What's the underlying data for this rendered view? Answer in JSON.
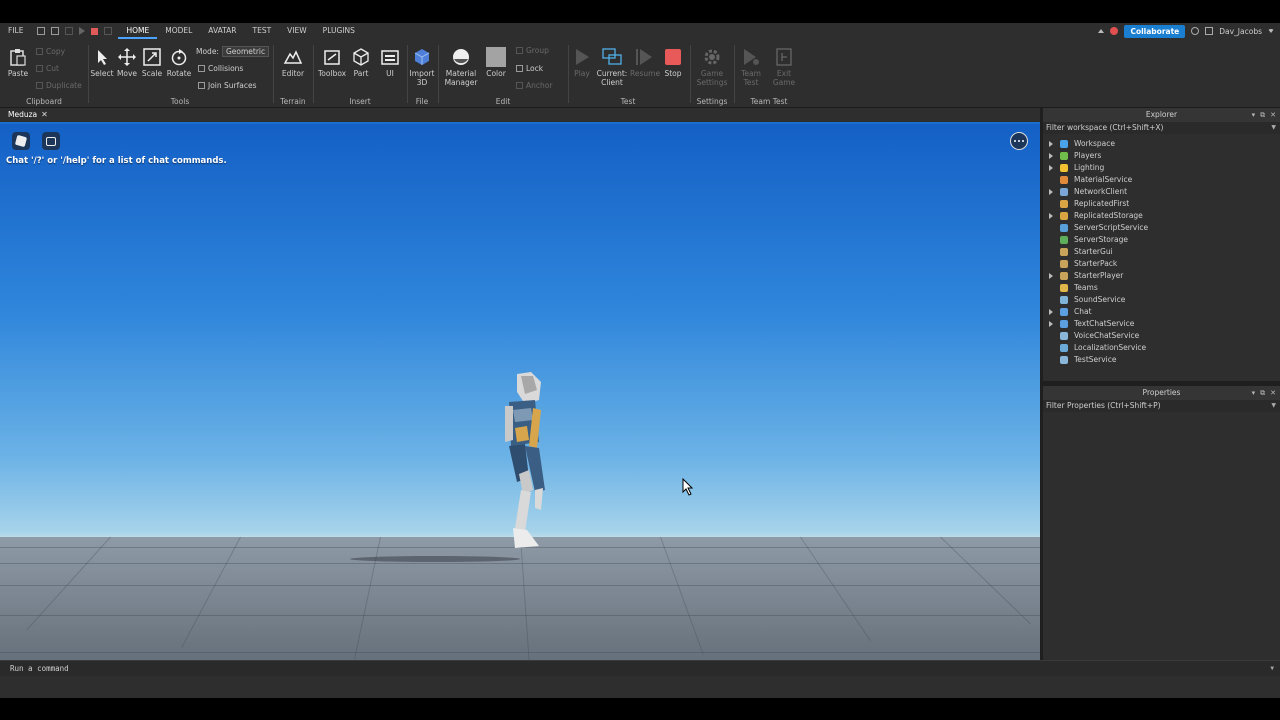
{
  "menu": {
    "file": "FILE",
    "tabs": [
      "HOME",
      "MODEL",
      "AVATAR",
      "TEST",
      "VIEW",
      "PLUGINS"
    ],
    "active_tab": "HOME",
    "collaborate": "Collaborate",
    "username": "Dav_Jacobs"
  },
  "ribbon": {
    "clipboard": {
      "paste": "Paste",
      "copy": "Copy",
      "cut": "Cut",
      "duplicate": "Duplicate",
      "label": "Clipboard"
    },
    "tools": {
      "select": "Select",
      "move": "Move",
      "scale": "Scale",
      "rotate": "Rotate",
      "mode_label": "Mode:",
      "mode_value": "Geometric",
      "collisions": "Collisions",
      "join_surfaces": "Join Surfaces",
      "label": "Tools"
    },
    "terrain": {
      "editor": "Editor",
      "label": "Terrain"
    },
    "insert": {
      "toolbox": "Toolbox",
      "part": "Part",
      "ui": "UI",
      "label": "Insert"
    },
    "file": {
      "import_3d_line1": "Import",
      "import_3d_line2": "3D",
      "label": "File"
    },
    "edit": {
      "material_line1": "Material",
      "material_line2": "Manager",
      "color": "Color",
      "group": "Group",
      "lock": "Lock",
      "anchor": "Anchor",
      "label": "Edit"
    },
    "test": {
      "play": "Play",
      "current_line1": "Current:",
      "current_line2": "Client",
      "resume": "Resume",
      "stop": "Stop",
      "label": "Test"
    },
    "settings": {
      "game_line1": "Game",
      "game_line2": "Settings",
      "label": "Settings"
    },
    "team_test": {
      "team_line1": "Team",
      "team_line2": "Test",
      "exit_line1": "Exit",
      "exit_line2": "Game",
      "label": "Team Test"
    }
  },
  "document_tab": "Meduza",
  "viewport": {
    "chat_hint": "Chat '/?' or '/help' for a list of chat commands."
  },
  "explorer": {
    "title": "Explorer",
    "filter": "Filter workspace (Ctrl+Shift+X)",
    "items": [
      {
        "label": "Workspace",
        "expandable": true,
        "color": "#4aa3e8"
      },
      {
        "label": "Players",
        "expandable": true,
        "color": "#6fbf4a"
      },
      {
        "label": "Lighting",
        "expandable": true,
        "color": "#f2c230"
      },
      {
        "label": "MaterialService",
        "expandable": false,
        "color": "#e08a3a"
      },
      {
        "label": "NetworkClient",
        "expandable": true,
        "color": "#7aa7d8"
      },
      {
        "label": "ReplicatedFirst",
        "expandable": false,
        "color": "#d9a441"
      },
      {
        "label": "ReplicatedStorage",
        "expandable": true,
        "color": "#d9a441"
      },
      {
        "label": "ServerScriptService",
        "expandable": false,
        "color": "#5aa0d8"
      },
      {
        "label": "ServerStorage",
        "expandable": false,
        "color": "#5fae5a"
      },
      {
        "label": "StarterGui",
        "expandable": false,
        "color": "#c7a45a"
      },
      {
        "label": "StarterPack",
        "expandable": false,
        "color": "#c7a45a"
      },
      {
        "label": "StarterPlayer",
        "expandable": true,
        "color": "#c7a45a"
      },
      {
        "label": "Teams",
        "expandable": false,
        "color": "#e0b54a"
      },
      {
        "label": "SoundService",
        "expandable": false,
        "color": "#7fb3d8"
      },
      {
        "label": "Chat",
        "expandable": true,
        "color": "#5b9fe0"
      },
      {
        "label": "TextChatService",
        "expandable": true,
        "color": "#5b9fe0"
      },
      {
        "label": "VoiceChatService",
        "expandable": false,
        "color": "#8bb6d8"
      },
      {
        "label": "LocalizationService",
        "expandable": false,
        "color": "#6aa9d8"
      },
      {
        "label": "TestService",
        "expandable": false,
        "color": "#8bb6d8"
      }
    ]
  },
  "properties": {
    "title": "Properties",
    "filter": "Filter Properties (Ctrl+Shift+P)"
  },
  "command_bar": {
    "placeholder": "Run a command"
  }
}
